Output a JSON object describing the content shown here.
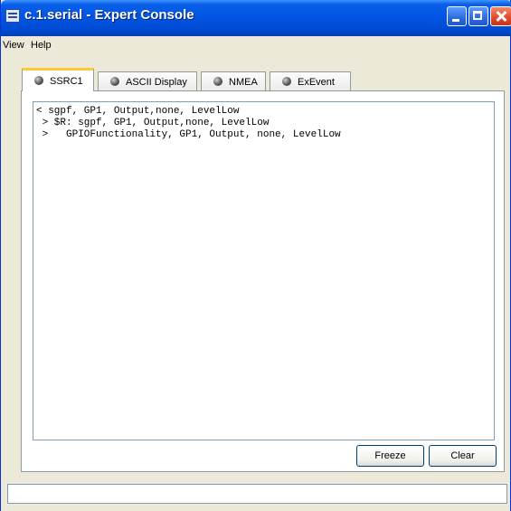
{
  "window": {
    "title": "c.1.serial - Expert Console"
  },
  "menu": {
    "view": "View",
    "help": "Help"
  },
  "tabs": [
    {
      "label": "SSRC1",
      "active": true
    },
    {
      "label": "ASCII Display",
      "active": false
    },
    {
      "label": "NMEA",
      "active": false
    },
    {
      "label": "ExEvent",
      "active": false
    }
  ],
  "console": {
    "lines": [
      "< sgpf, GP1, Output,none, LevelLow",
      " > $R: sgpf, GP1, Output,none, LevelLow",
      " >   GPIOFunctionality, GP1, Output, none, LevelLow"
    ]
  },
  "buttons": {
    "freeze": "Freeze",
    "clear": "Clear"
  },
  "status": {
    "text": ""
  },
  "colors": {
    "titlebar": "#0054e3",
    "active_tab_accent": "#ffc83c",
    "close_button": "#e0492b"
  },
  "icons": {
    "app": "console-app-icon",
    "tab": "status-dot-icon"
  }
}
